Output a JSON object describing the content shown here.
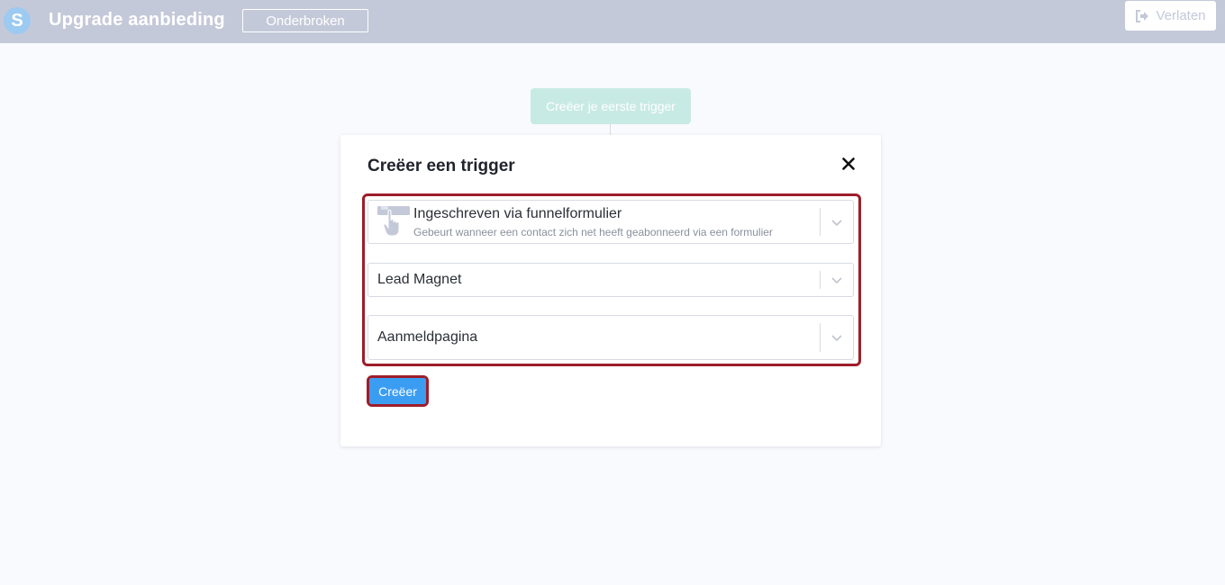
{
  "header": {
    "logo_letter": "S",
    "title": "Upgrade aanbieding",
    "status": "Onderbroken",
    "leave_label": "Verlaten"
  },
  "canvas": {
    "first_trigger_label": "Creëer je eerste trigger"
  },
  "modal": {
    "title": "Creëer een trigger",
    "trigger_type": {
      "label": "Ingeschreven via funnelformulier",
      "description": "Gebeurt wanneer een contact zich net heeft geabonneerd via een formulier",
      "icon": "hand-pointer-icon"
    },
    "funnel_select": {
      "value": "Lead Magnet"
    },
    "page_select": {
      "value": "Aanmeldpagina"
    },
    "create_label": "Creëer"
  },
  "colors": {
    "topbar": "#c4c9d9",
    "accent_blue": "#3a9df2",
    "highlight_red": "#9e1d2a",
    "teal_button": "#c8eae4"
  }
}
